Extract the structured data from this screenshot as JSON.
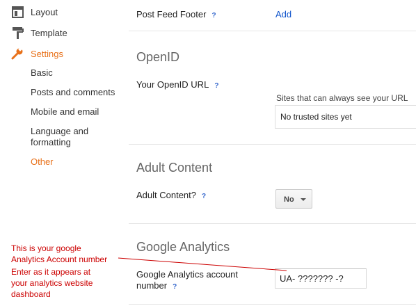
{
  "sidebar": {
    "top_items": [
      {
        "label": "Layout",
        "icon": "layout-icon"
      },
      {
        "label": "Template",
        "icon": "paint-roller-icon"
      },
      {
        "label": "Settings",
        "icon": "wrench-icon",
        "active": true
      }
    ],
    "sub_items": [
      {
        "label": "Basic"
      },
      {
        "label": "Posts and comments"
      },
      {
        "label": "Mobile and email"
      },
      {
        "label": "Language and formatting"
      },
      {
        "label": "Other",
        "active": true
      }
    ]
  },
  "main": {
    "post_feed_footer": {
      "label": "Post Feed Footer",
      "help": "?",
      "action": "Add"
    },
    "openid": {
      "title": "OpenID",
      "url_label": "Your OpenID URL",
      "help": "?",
      "trusted_caption": "Sites that can always see your URL",
      "trusted_empty": "No trusted sites yet"
    },
    "adult": {
      "title": "Adult Content",
      "label": "Adult Content?",
      "help": "?",
      "value": "No"
    },
    "analytics": {
      "title": "Google Analytics",
      "label": "Google Analytics account number",
      "help": "?",
      "value": "UA- ??????? -?"
    }
  },
  "annotation": {
    "line1": "This is your google",
    "line2": "Analytics Account number",
    "line3": "Enter as it appears at",
    "line4": "your analytics website",
    "line5": "dashboard",
    "color": "#cc0000"
  },
  "colors": {
    "accent": "#e8711a",
    "link": "#1155cc"
  }
}
